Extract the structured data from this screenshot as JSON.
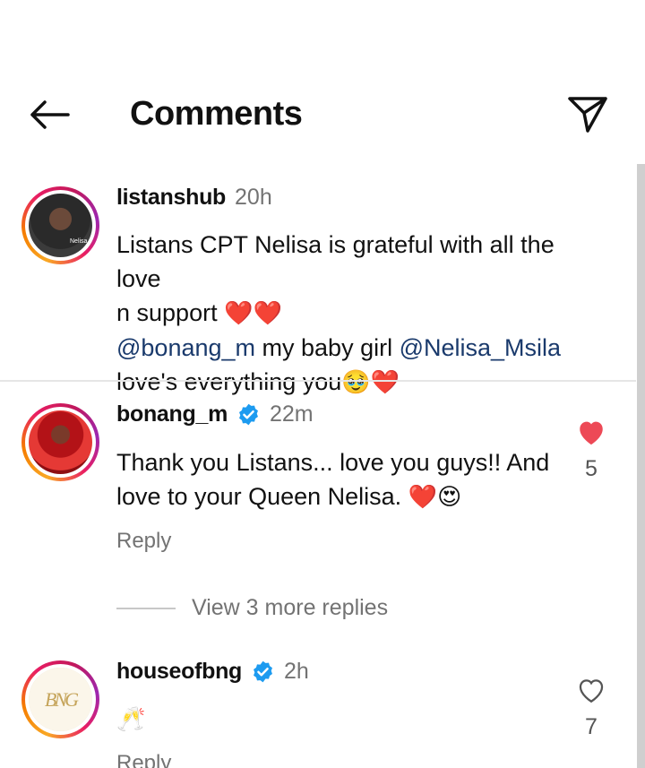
{
  "header": {
    "title": "Comments",
    "back_icon": "arrow-left-icon",
    "send_icon": "send-icon"
  },
  "colors": {
    "mention": "#1a3a6c",
    "like_red": "#ed4956",
    "verified_blue": "#1d9bf0",
    "muted": "#737373"
  },
  "comments": [
    {
      "username": "listanshub",
      "time": "20h",
      "verified": false,
      "avatar_label": "Nelisa",
      "text_line1": "Listans CPT Nelisa is grateful with all the love",
      "text_line2": "n support",
      "emoji_line2": "❤️❤️",
      "mention1": "@bonang_m",
      "text_mid": "my baby girl",
      "mention2": "@Nelisa_Msila",
      "text_line4": "love's everything you",
      "emoji_line4": "🥹❤️"
    },
    {
      "username": "bonang_m",
      "time": "22m",
      "verified": true,
      "text_line1": "Thank you Listans... love you guys!! And",
      "text_line2": "love to your Queen Nelisa.",
      "emoji_line2": "❤️😍",
      "reply_label": "Reply",
      "liked": true,
      "like_count": "5"
    },
    {
      "username": "houseofbng",
      "time": "2h",
      "verified": true,
      "avatar_label": "BNG",
      "emoji_text": "🥂",
      "reply_label": "Reply",
      "liked": false,
      "like_count": "7"
    }
  ],
  "view_replies": "View 3 more replies"
}
